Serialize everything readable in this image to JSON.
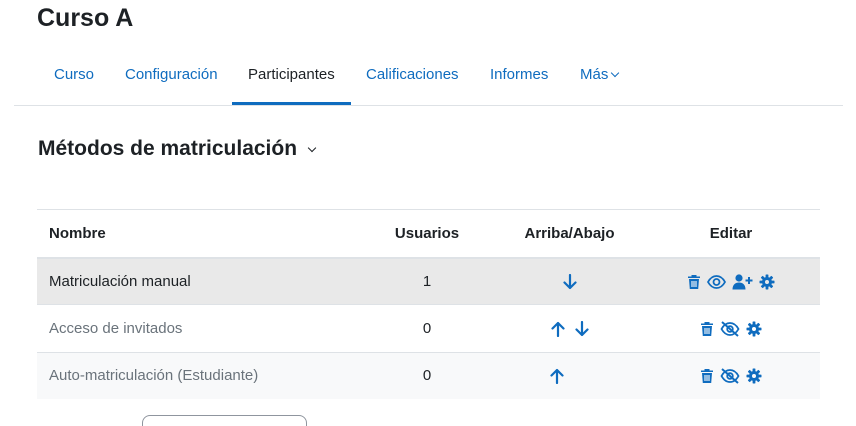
{
  "course": {
    "title": "Curso A"
  },
  "tabs": [
    {
      "label": "Curso"
    },
    {
      "label": "Configuración"
    },
    {
      "label": "Participantes"
    },
    {
      "label": "Calificaciones"
    },
    {
      "label": "Informes"
    },
    {
      "label": "Más"
    }
  ],
  "page": {
    "heading": "Métodos de matriculación"
  },
  "table": {
    "headers": {
      "name": "Nombre",
      "users": "Usuarios",
      "updown": "Arriba/Abajo",
      "edit": "Editar"
    },
    "rows": [
      {
        "name": "Matriculación manual",
        "users": "1",
        "arrows": [
          "down-arrow-icon"
        ],
        "edit_icons": [
          "trash-icon",
          "eye-icon",
          "user-plus-icon",
          "gear-icon"
        ]
      },
      {
        "name": "Acceso de invitados",
        "users": "0",
        "arrows": [
          "up-arrow-icon",
          "down-arrow-icon"
        ],
        "edit_icons": [
          "trash-icon",
          "eye-slash-icon",
          "gear-icon"
        ]
      },
      {
        "name": "Auto-matriculación (Estudiante)",
        "users": "0",
        "arrows": [
          "up-arrow-icon"
        ],
        "edit_icons": [
          "trash-icon",
          "eye-slash-icon",
          "gear-icon"
        ]
      }
    ]
  },
  "colors": {
    "link": "#0f6cbf",
    "text": "#1d2125",
    "muted": "#6a737b",
    "highlight_row": "#e9e9e9"
  }
}
